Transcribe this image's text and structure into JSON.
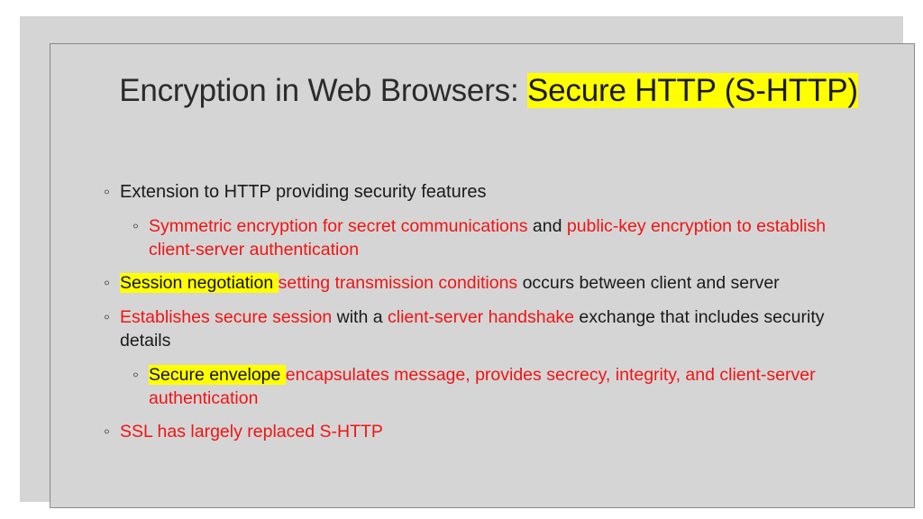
{
  "slide": {
    "background_color": "#d5d5d5",
    "page_background": "#ffffff",
    "frame_border_color": "#8a8a8a",
    "highlight_color": "#ffff00",
    "accent_red": "#f01414",
    "text_color": "#1a1a1a",
    "title_color": "#2b2b2b",
    "bullet_glyph": "◦"
  },
  "title": {
    "plain_prefix": "Encryption in Web Browsers: ",
    "highlighted": "Secure HTTP (S-HTTP)",
    "full_text": "Encryption in Web Browsers: Secure HTTP (S-HTTP)"
  },
  "body": {
    "bullets": [
      {
        "level": 1,
        "marker": "◦",
        "segments": [
          {
            "text": "Extension to HTTP providing security features",
            "style": "black"
          }
        ]
      },
      {
        "level": 2,
        "marker": "◦",
        "segments": [
          {
            "text": "Symmetric encryption for secret communications",
            "style": "red"
          },
          {
            "text": " and ",
            "style": "black"
          },
          {
            "text": "public-key encryption to establish client-server authentication",
            "style": "red"
          }
        ]
      },
      {
        "level": 1,
        "marker": "◦",
        "segments": [
          {
            "text": "Session negotiation ",
            "style": "highlight"
          },
          {
            "text": "setting transmission conditions",
            "style": "red"
          },
          {
            "text": " occurs between client and server",
            "style": "black"
          }
        ]
      },
      {
        "level": 1,
        "marker": "◦",
        "segments": [
          {
            "text": "Establishes secure session",
            "style": "red"
          },
          {
            "text": " with a ",
            "style": "black"
          },
          {
            "text": "client-server handshake",
            "style": "red"
          },
          {
            "text": " exchange that includes security details",
            "style": "black"
          }
        ]
      },
      {
        "level": 2,
        "marker": "◦",
        "segments": [
          {
            "text": "Secure envelope ",
            "style": "highlight"
          },
          {
            "text": "encapsulates message, provides secrecy, integrity, and client-server authentication",
            "style": "red"
          }
        ]
      },
      {
        "level": 1,
        "marker": "◦",
        "segments": [
          {
            "text": "SSL has largely replaced S-HTTP",
            "style": "red"
          }
        ]
      }
    ]
  }
}
